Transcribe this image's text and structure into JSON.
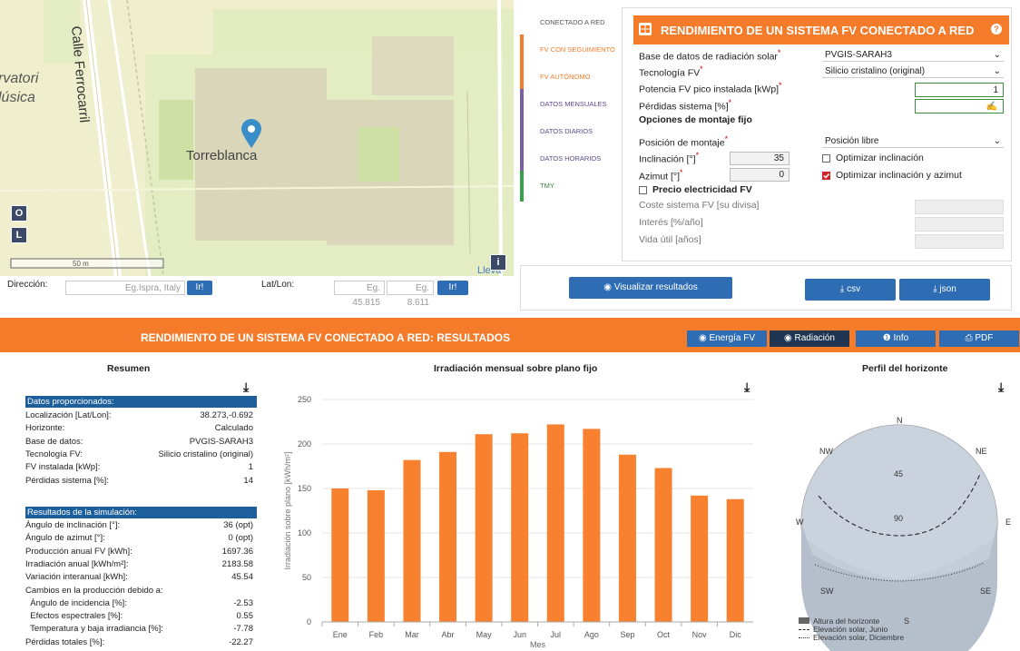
{
  "map": {
    "labels": {
      "street": "Calle Ferrocarril",
      "observatory_1": "rvatori",
      "observatory_2": "lúsica",
      "place": "Torreblanca",
      "scale": "50 m",
      "bottom_partial": "Lleva"
    },
    "buttons": {
      "o": "O",
      "l": "L",
      "info": "i"
    }
  },
  "address": {
    "direccion_label": "Dirección:",
    "direccion_placeholder": "Eg.Ispra, Italy",
    "go1": "Ir!",
    "latlon_label": "Lat/Lon:",
    "lat_placeholder": "Eg. 45.815",
    "lon_placeholder": "Eg. 8.611",
    "go2": "Ir!"
  },
  "tabs": [
    {
      "label": "CONECTADO A RED",
      "color": "#f47b2a"
    },
    {
      "label": "FV CON SEGUIMIENTO",
      "color": "#f47b2a"
    },
    {
      "label": "FV AUTÓNOMO",
      "color": "#f47b2a"
    },
    {
      "label": "DATOS MENSUALES",
      "color": "#7a5ea8"
    },
    {
      "label": "DATOS DIARIOS",
      "color": "#7a5ea8"
    },
    {
      "label": "DATOS HORARIOS",
      "color": "#7a5ea8"
    },
    {
      "label": "TMY",
      "color": "#3aa14b"
    }
  ],
  "form": {
    "title": "RENDIMIENTO DE UN SISTEMA FV CONECTADO A RED",
    "help": "?",
    "radiation_db_label": "Base de datos de radiación solar",
    "radiation_db_value": "PVGIS-SARAH3",
    "pv_tech_label": "Tecnología FV",
    "pv_tech_value": "Silicio cristalino (original)",
    "peak_power_label": "Potencia FV pico instalada [kWp]",
    "peak_power_value": "1",
    "losses_label": "Pérdidas sistema [%]",
    "losses_value": "14",
    "mount_heading": "Opciones de montaje fijo",
    "mount_pos_label": "Posición de montaje",
    "mount_pos_value": "Posición libre",
    "incl_label": "Inclinación [°]",
    "incl_value": "35",
    "azim_label": "Azimut [°]",
    "azim_value": "0",
    "opt_incl_label": "Optimizar inclinación",
    "opt_incl_azim_label": "Optimizar inclinación y azimut",
    "price_label": "Precio electricidad FV",
    "cost_label": "Coste sistema FV [su divisa]",
    "interest_label": "Interés [%/año]",
    "life_label": "Vida útil [años]",
    "star": "*"
  },
  "actions": {
    "visualize": "Visualizar resultados",
    "csv": "csv",
    "json": "json"
  },
  "results": {
    "title": "RENDIMIENTO DE UN SISTEMA FV CONECTADO A RED: RESULTADOS",
    "btn_energy": "Energía FV",
    "btn_radiation": "Radiación",
    "btn_info": "Info",
    "btn_pdf": "PDF",
    "summary_title": "Resumen",
    "provided_header": "Datos proporcionados:",
    "provided": [
      {
        "k": "Localización [Lat/Lon]:",
        "v": "38.273,-0.692"
      },
      {
        "k": "Horizonte:",
        "v": "Calculado"
      },
      {
        "k": "Base de datos:",
        "v": "PVGIS-SARAH3"
      },
      {
        "k": "Tecnología FV:",
        "v": "Silicio cristalino (original)"
      },
      {
        "k": "FV instalada [kWp]:",
        "v": "1"
      },
      {
        "k": "Pérdidas sistema [%]:",
        "v": "14"
      }
    ],
    "sim_header": "Resultados de la simulación:",
    "sim": [
      {
        "k": "Ángulo de inclinación [°]:",
        "v": "36 (opt)"
      },
      {
        "k": "Ángulo de azimut [°]:",
        "v": "0 (opt)"
      },
      {
        "k": "Producción anual FV [kWh]:",
        "v": "1697.36"
      },
      {
        "k": "Irradiación anual [kWh/m²]:",
        "v": "2183.58"
      },
      {
        "k": "Variación interanual [kWh]:",
        "v": "45.54"
      },
      {
        "k": "Cambios en la producción debido a:",
        "v": ""
      },
      {
        "k": "  Ángulo de incidencia [%]:",
        "v": "-2.53"
      },
      {
        "k": "  Efectos espectrales [%]:",
        "v": "0.55"
      },
      {
        "k": "  Temperatura y baja irradiancia [%]:",
        "v": "-7.78"
      },
      {
        "k": "Pérdidas totales [%]:",
        "v": "-22.27"
      }
    ],
    "horizon_title": "Perfil del horizonte",
    "horizon_labels": {
      "n": "N",
      "ne": "NE",
      "e": "E",
      "se": "SE",
      "s": "S",
      "sw": "SW",
      "w": "W",
      "nw": "NW",
      "r45": "45",
      "r90": "90"
    },
    "horizon_legend": [
      "Altura del horizonte",
      "Elevación solar, Junio",
      "Elevación solar, Diciembre"
    ]
  },
  "chart_data": {
    "type": "bar",
    "title": "Irradiación mensual sobre plano fijo",
    "xlabel": "Mes",
    "ylabel": "Irradiación sobre plano [kWh/m²]",
    "categories": [
      "Ene",
      "Feb",
      "Mar",
      "Abr",
      "May",
      "Jun",
      "Jul",
      "Ago",
      "Sep",
      "Oct",
      "Nov",
      "Dic"
    ],
    "values": [
      150,
      148,
      182,
      191,
      211,
      212,
      222,
      217,
      188,
      173,
      142,
      138
    ],
    "ylim": [
      0,
      250
    ],
    "yticks": [
      0,
      50,
      100,
      150,
      200,
      250
    ],
    "bar_color": "#f7812f",
    "grid": true
  },
  "colors": {
    "orange": "#f47b2a",
    "blue": "#2e6db4",
    "navy": "#1d5f9b",
    "dark": "#1f3552"
  }
}
